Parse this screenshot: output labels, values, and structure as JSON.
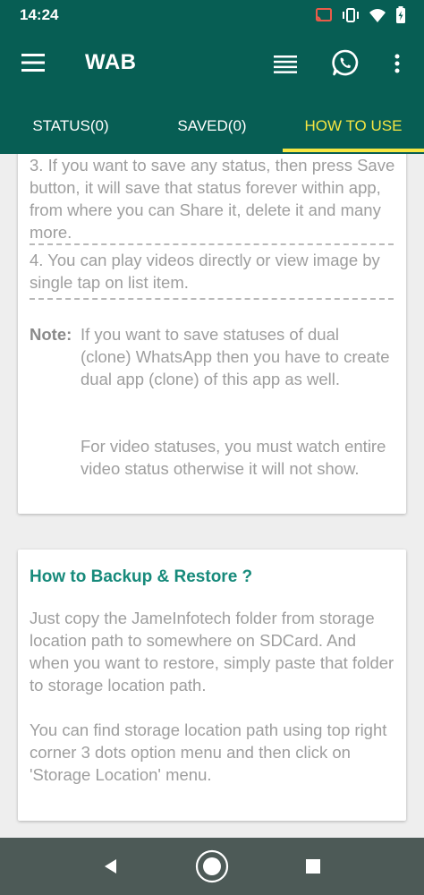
{
  "status_bar": {
    "time": "14:24",
    "icons": [
      "cast-icon",
      "vibrate-icon",
      "wifi-icon",
      "battery-icon"
    ]
  },
  "app_bar": {
    "title": "WAB",
    "actions": [
      "menu-icon",
      "list-icon",
      "whatsapp-icon",
      "more-vert-icon"
    ]
  },
  "tabs": [
    {
      "label": "STATUS(0)",
      "active": false
    },
    {
      "label": "SAVED(0)",
      "active": false
    },
    {
      "label": "HOW TO USE",
      "active": true
    }
  ],
  "colors": {
    "primary": "#075e54",
    "accent_tab": "#f5e642",
    "card_title": "#178a7b",
    "body_text": "#9e9e9e"
  },
  "usage_card": {
    "step3": "3. If you want to save any status, then press Save button, it will save that status forever within app, from where you can Share it, delete it and many more.",
    "step4": "4. You can play videos directly or view image by single tap on list item.",
    "note_label": "Note:",
    "note_text_1": "If you want to save statuses of dual (clone) WhatsApp then you have to create dual app (clone) of this app as well.",
    "note_text_2": "For video statuses, you must watch entire video status otherwise it will not show."
  },
  "backup_card": {
    "title": "How to Backup & Restore ?",
    "para1": "Just copy the JameInfotech folder from storage location path to somewhere on SDCard. And when you want to restore, simply paste that folder to storage location path.",
    "para2": "You can find storage location path using top right corner 3 dots option menu and then click on 'Storage Location' menu."
  },
  "nav_bar": {
    "buttons": [
      "back-icon",
      "home-icon",
      "recents-icon"
    ]
  }
}
